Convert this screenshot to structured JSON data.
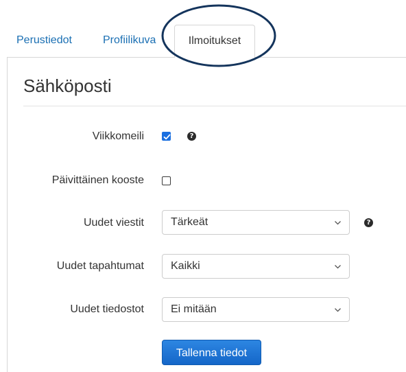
{
  "tabs": [
    {
      "label": "Perustiedot",
      "active": false
    },
    {
      "label": "Profiilikuva",
      "active": false
    },
    {
      "label": "Ilmoitukset",
      "active": true
    }
  ],
  "section": {
    "title": "Sähköposti"
  },
  "form": {
    "weekly_email": {
      "label": "Viikkomeili",
      "checked": true,
      "has_help": true,
      "help_glyph": "?"
    },
    "daily_digest": {
      "label": "Päivittäinen kooste",
      "checked": false
    },
    "new_messages": {
      "label": "Uudet viestit",
      "selected": "Tärkeät",
      "has_help": true,
      "help_glyph": "?"
    },
    "new_events": {
      "label": "Uudet tapahtumat",
      "selected": "Kaikki"
    },
    "new_files": {
      "label": "Uudet tiedostot",
      "selected": "Ei mitään"
    }
  },
  "buttons": {
    "save_label": "Tallenna tiedot"
  },
  "annotation": {
    "shape": "ellipse",
    "color": "#14345c",
    "target": "Ilmoitukset"
  },
  "colors": {
    "link": "#1a6fb3",
    "primary_button": "#1a74d6",
    "checkbox_checked": "#1a6fe0"
  },
  "icons": {
    "help": "question-circle-icon",
    "dropdown": "chevron-down-icon",
    "check": "check-icon"
  }
}
